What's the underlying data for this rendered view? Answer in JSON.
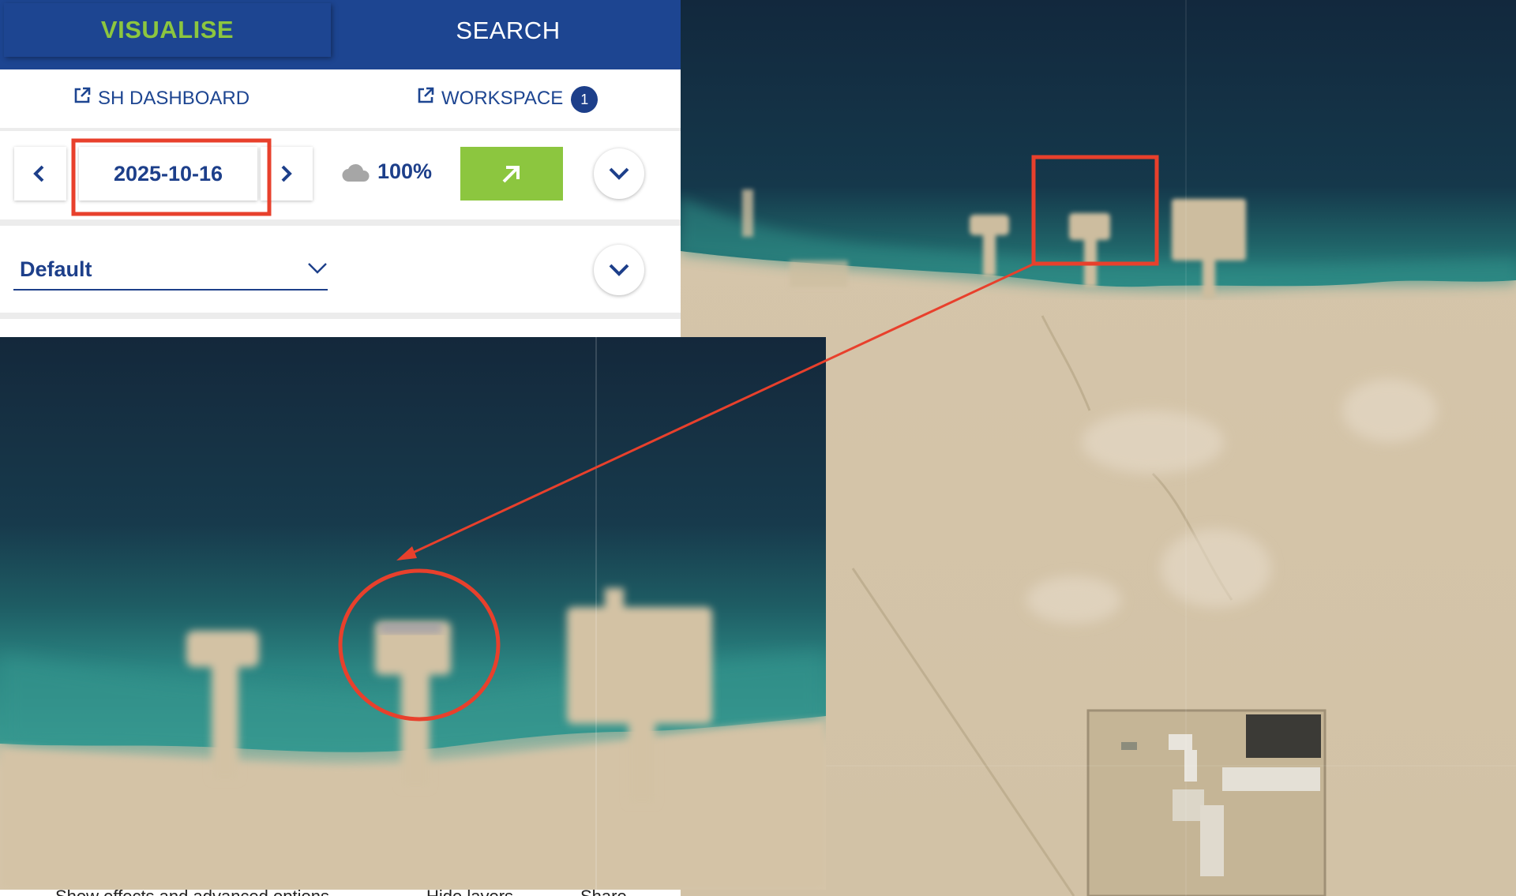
{
  "tabs": [
    {
      "label": "VISUALISE",
      "active": true
    },
    {
      "label": "SEARCH",
      "active": false
    }
  ],
  "links": {
    "dashboard": "SH DASHBOARD",
    "workspace": "WORKSPACE",
    "workspace_count": "1"
  },
  "date_bar": {
    "date": "2025-10-16",
    "cloud_coverage": "100%",
    "prev_icon": "chevron-left-icon",
    "next_icon": "chevron-right-icon",
    "cloud_icon": "cloud-icon",
    "search_icon": "arrow-up-right-icon"
  },
  "layer": {
    "selected": "Default"
  },
  "footer_partial": {
    "left": "Show effects and advanced options",
    "middle": "Hide layers",
    "right": "Share"
  },
  "colors": {
    "brand_blue": "#1d4591",
    "accent_green": "#8cc63f",
    "annotation_red": "#e8402c"
  }
}
